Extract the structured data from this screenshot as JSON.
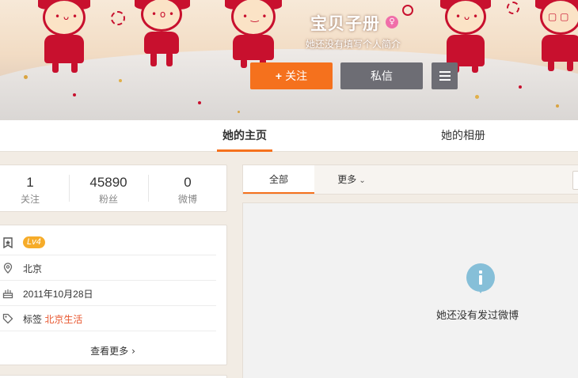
{
  "profile": {
    "name": "宝贝子册",
    "bio": "她还没有填写个人简介",
    "gender_icon": "female-icon"
  },
  "actions": {
    "follow_label": "关注",
    "follow_icon": "plus-icon",
    "message_label": "私信",
    "menu_icon": "hamburger-menu-icon"
  },
  "nav": {
    "tabs": [
      {
        "label": "她的主页",
        "active": true
      },
      {
        "label": "她的相册",
        "active": false
      }
    ]
  },
  "stats": [
    {
      "value": "1",
      "label": "关注"
    },
    {
      "value": "45890",
      "label": "粉丝"
    },
    {
      "value": "0",
      "label": "微博"
    }
  ],
  "info": {
    "level": "Lv4",
    "location": "北京",
    "join_date": "2011年10月28日",
    "tag_label": "标签",
    "tag_value": "北京生活",
    "more_label": "查看更多"
  },
  "feed": {
    "tabs": {
      "all": "全部",
      "more": "更多"
    },
    "empty_text": "她还没有发过微博"
  },
  "colors": {
    "accent": "#f5711d",
    "secondary_button": "#6d6d74",
    "level_badge": "#f6ac2a",
    "tag_link": "#e8572f",
    "info_icon": "#86bfd8"
  }
}
